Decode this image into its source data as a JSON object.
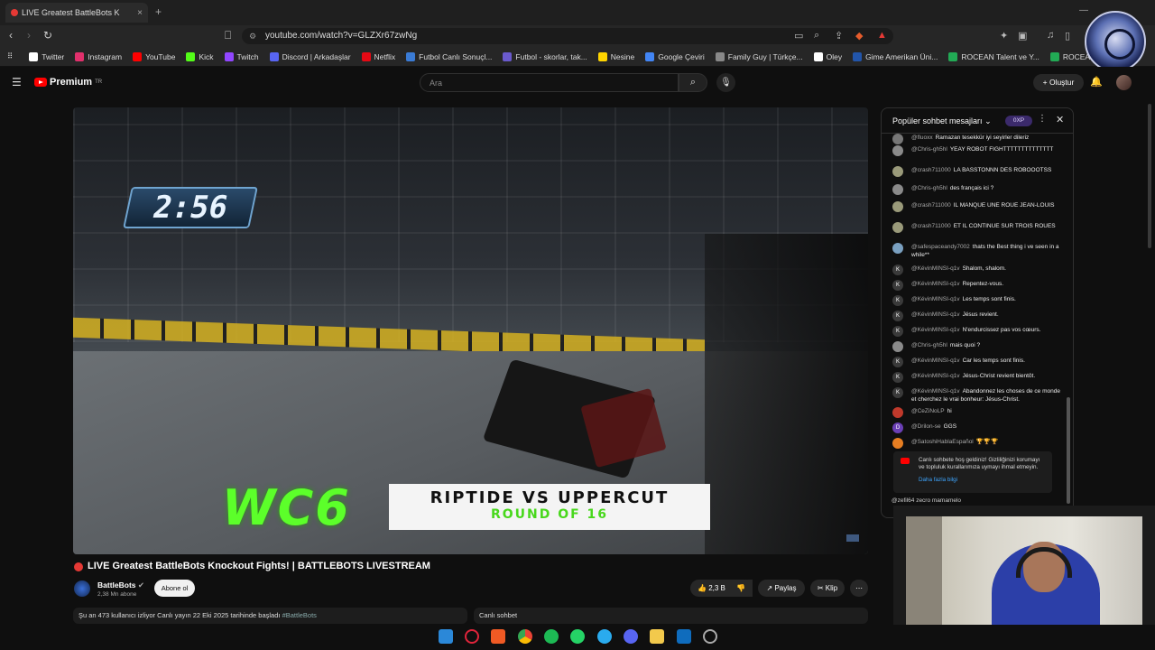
{
  "browser": {
    "tab_title": "LIVE Greatest BattleBots K",
    "url": "youtube.com/watch?v=GLZXr67zwNg",
    "bookmarks": [
      {
        "label": "Twitter",
        "color": "#ffffff"
      },
      {
        "label": "Instagram",
        "color": "#e1306c"
      },
      {
        "label": "YouTube",
        "color": "#ff0000"
      },
      {
        "label": "Kick",
        "color": "#53fc18"
      },
      {
        "label": "Twitch",
        "color": "#9146ff"
      },
      {
        "label": "Discord | Arkadaşlar",
        "color": "#5865f2"
      },
      {
        "label": "Netflix",
        "color": "#e50914"
      },
      {
        "label": "Futbol Canlı Sonuçl...",
        "color": "#3a7bd5"
      },
      {
        "label": "Futbol - skorlar, tak...",
        "color": "#6a5acd"
      },
      {
        "label": "Nesine",
        "color": "#ffd500"
      },
      {
        "label": "Google Çeviri",
        "color": "#4285f4"
      },
      {
        "label": "Family Guy | Türkçe...",
        "color": "#888888"
      },
      {
        "label": "Oley",
        "color": "#ffffff"
      },
      {
        "label": "Gime Amerikan Üni...",
        "color": "#2255aa"
      },
      {
        "label": "ROCEAN Talent ve Y...",
        "color": "#22aa55"
      },
      {
        "label": "ROCEAN Esports -...",
        "color": "#22aa55"
      }
    ]
  },
  "youtube": {
    "logo_text": "Premium",
    "logo_sup": "TR",
    "search_placeholder": "Ara",
    "create_label": "Oluştur"
  },
  "video": {
    "timer": "2:56",
    "event": "WC6",
    "matchup": "RIPTIDE VS UPPERCUT",
    "round": "ROUND OF 16",
    "title": "LIVE Greatest BattleBots Knockout Fights! | BATTLEBOTS LIVESTREAM",
    "channel": "BattleBots",
    "subscribers": "2,38 Mn abone",
    "subscribe_label": "Abone ol",
    "likes": "2,3 B",
    "share_label": "Paylaş",
    "clip_label": "Klip",
    "description": "Şu an 473 kullanıcı izliyor  Canlı yayın 22 Eki 2025 tarihinde başladı",
    "hashtag": "#BattleBots",
    "live_chat_label": "Canlı sohbet"
  },
  "chat": {
    "header": "Popüler sohbet mesajları",
    "xp": "0XP",
    "messages": [
      {
        "author": "@fluoxx",
        "text": "Ramazan tesekkür iyi seyirler dileriz",
        "avatar": "#777777",
        "initial": ""
      },
      {
        "author": "@Chris-gh5hl",
        "text": "YEAY ROBOT FIGHTTTTTTTTTTTTTT",
        "avatar": "#8a8a8a",
        "initial": ""
      },
      {
        "author": "@crash711000",
        "text": "LA BASSTONNN DES ROBOOOTSS",
        "avatar": "#9a9a7a",
        "initial": ""
      },
      {
        "author": "@Chris-gh5hl",
        "text": "des français ici ?",
        "avatar": "#8a8a8a",
        "initial": ""
      },
      {
        "author": "@crash711000",
        "text": "IL MANQUE UNE ROUE JEAN-LOUIS",
        "avatar": "#9a9a7a",
        "initial": ""
      },
      {
        "author": "@crash711000",
        "text": "ET IL CONTINUE SUR TROIS ROUES",
        "avatar": "#9a9a7a",
        "initial": ""
      },
      {
        "author": "@safespaceandy7002",
        "text": "thats the Best thing i ve seen in a while**",
        "avatar": "#7aa0c0",
        "initial": ""
      },
      {
        "author": "@KévinMINSI-q1v",
        "text": "Shalom, shalom.",
        "avatar": "#3a3a3a",
        "initial": "K"
      },
      {
        "author": "@KévinMINSI-q1v",
        "text": "Repentez-vous.",
        "avatar": "#3a3a3a",
        "initial": "K"
      },
      {
        "author": "@KévinMINSI-q1v",
        "text": "Les temps sont finis.",
        "avatar": "#3a3a3a",
        "initial": "K"
      },
      {
        "author": "@KévinMINSI-q1v",
        "text": "Jésus revient.",
        "avatar": "#3a3a3a",
        "initial": "K"
      },
      {
        "author": "@KévinMINSI-q1v",
        "text": "N'endurcissez pas vos cœurs.",
        "avatar": "#3a3a3a",
        "initial": "K"
      },
      {
        "author": "@Chris-gh5hl",
        "text": "mais quoi ?",
        "avatar": "#8a8a8a",
        "initial": ""
      },
      {
        "author": "@KévinMINSI-q1v",
        "text": "Car les temps sont finis.",
        "avatar": "#3a3a3a",
        "initial": "K"
      },
      {
        "author": "@KévinMINSI-q1v",
        "text": "Jésus-Christ revient bientôt.",
        "avatar": "#3a3a3a",
        "initial": "K"
      },
      {
        "author": "@KévinMINSI-q1v",
        "text": "Abandonnez les choses de ce monde et cherchez le vrai bonheur: Jésus-Christ.",
        "avatar": "#3a3a3a",
        "initial": "K"
      },
      {
        "author": "@CeZiNoLP",
        "text": "hi",
        "avatar": "#c0392b",
        "initial": ""
      },
      {
        "author": "@Drilon-se",
        "text": "GGS",
        "avatar": "#6a3fb5",
        "initial": "D"
      },
      {
        "author": "@SatoshiHablaEspañol",
        "text": "🏆🏆🏆",
        "avatar": "#e67e22",
        "initial": ""
      }
    ],
    "welcome_text": "Canlı sohbete hoş geldiniz! Gizliliğinizi korumayı ve topluluk kurallarımıza uymayı ihmal etmeyin.",
    "welcome_link": "Daha fazla bilgi",
    "partial_message": "@zefil64  zecro mamamelo"
  }
}
